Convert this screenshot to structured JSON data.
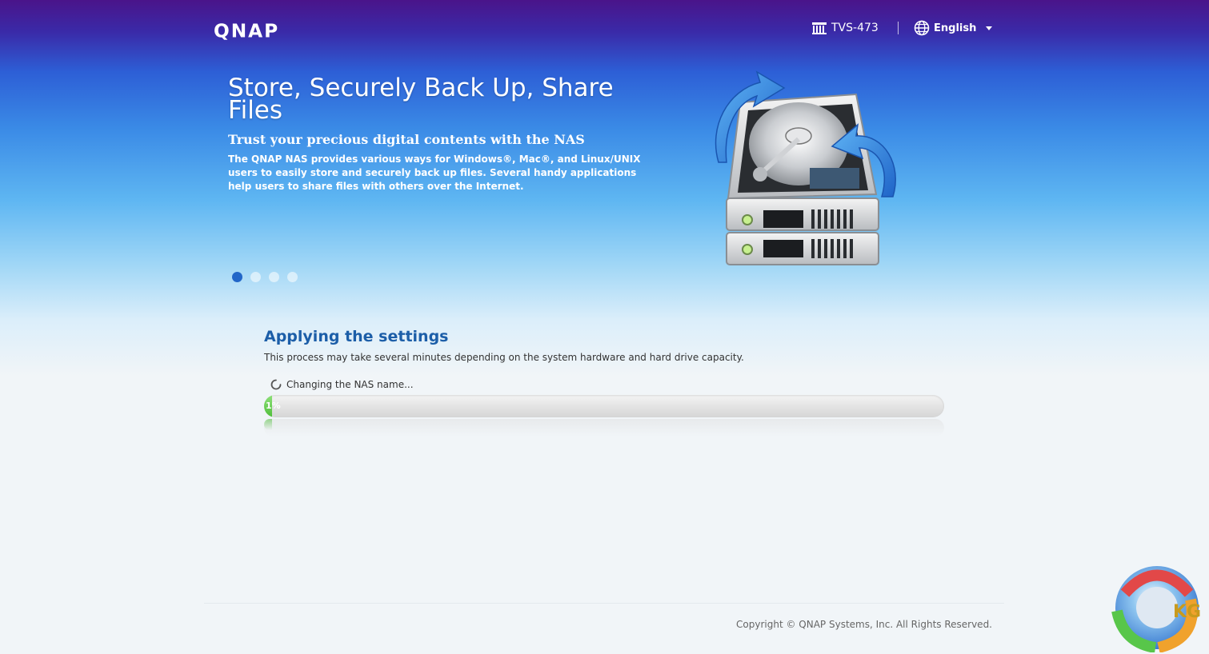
{
  "header": {
    "brand": "QNAP",
    "model_name": "TVS-473",
    "language": "English"
  },
  "hero": {
    "headline": "Store, Securely Back Up, Share Files",
    "subheadline": "Trust your precious digital contents with the NAS",
    "description": "The QNAP NAS provides various ways for Windows®, Mac®, and Linux/UNIX users to easily store and securely back up files. Several handy applications help users to share files with others over the Internet.",
    "slides_total": 4,
    "active_slide": 1
  },
  "progress": {
    "title": "Applying the settings",
    "note": "This process may take several minutes depending on the system hardware and hard drive capacity.",
    "status": "Changing the NAS name...",
    "percent_label": "1%",
    "percent": 1
  },
  "footer": {
    "copyright": "Copyright © QNAP Systems, Inc. All Rights Reserved."
  },
  "watermark": {
    "text": "KG"
  },
  "colors": {
    "title_blue": "#1c5ea8",
    "progress_green": "#4fbf3a",
    "active_dot": "#2266c8"
  }
}
